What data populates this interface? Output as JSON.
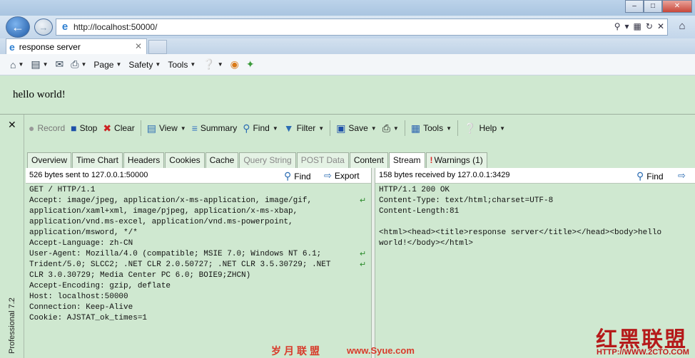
{
  "browser": {
    "url": "http://localhost:50000/",
    "tab_title": "response server",
    "command_bar": {
      "page": "Page",
      "safety": "Safety",
      "tools": "Tools"
    }
  },
  "page": {
    "text": "hello world!"
  },
  "fiddler": {
    "side_label": "Professional 7.2",
    "toolbar": {
      "record": "Record",
      "stop": "Stop",
      "clear": "Clear",
      "view": "View",
      "summary": "Summary",
      "find": "Find",
      "filter": "Filter",
      "save": "Save",
      "tools": "Tools",
      "help": "Help"
    },
    "tabs": [
      {
        "label": "Overview"
      },
      {
        "label": "Time Chart"
      },
      {
        "label": "Headers"
      },
      {
        "label": "Cookies"
      },
      {
        "label": "Cache"
      },
      {
        "label": "Query String"
      },
      {
        "label": "POST Data"
      },
      {
        "label": "Content"
      },
      {
        "label": "Stream"
      },
      {
        "label": "Warnings (1)"
      }
    ],
    "left": {
      "caption": "526 bytes sent to 127.0.0.1:50000",
      "find": "Find",
      "export": "Export",
      "lines": [
        "GET / HTTP/1.1",
        "Accept: image/jpeg, application/x-ms-application, image/gif,",
        "application/xaml+xml, image/pjpeg, application/x-ms-xbap,",
        "application/vnd.ms-excel, application/vnd.ms-powerpoint,",
        "application/msword, */*",
        "Accept-Language: zh-CN",
        "User-Agent: Mozilla/4.0 (compatible; MSIE 7.0; Windows NT 6.1;",
        "Trident/5.0; SLCC2; .NET CLR 2.0.50727; .NET CLR 3.5.30729; .NET",
        "CLR 3.0.30729; Media Center PC 6.0; BOIE9;ZHCN)",
        "Accept-Encoding: gzip, deflate",
        "Host: localhost:50000",
        "Connection: Keep-Alive",
        "Cookie: AJSTAT_ok_times=1"
      ]
    },
    "right": {
      "caption": "158 bytes received by 127.0.0.1:3429",
      "find": "Find",
      "lines": [
        "HTTP/1.1 200 OK",
        "Content-Type: text/html;charset=UTF-8",
        "Content-Length:81",
        "",
        "<html><head><title>response server</title></head><body>hello",
        "world!</body></html>"
      ]
    }
  },
  "watermarks": {
    "cn1": "岁月联盟",
    "site1": "www.Syue.com",
    "cn2": "红黑联盟",
    "site2": "HTTP://WWW.2CTO.COM"
  }
}
